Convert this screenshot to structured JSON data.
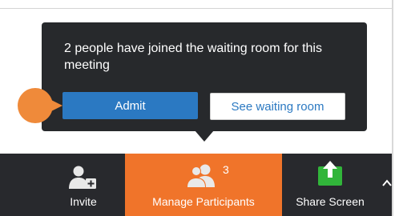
{
  "notification": {
    "message": "2 people have joined the waiting room for this meeting",
    "admit_label": "Admit",
    "see_waiting_room_label": "See waiting room"
  },
  "toolbar": {
    "invite_label": "Invite",
    "manage_participants_label": "Manage Participants",
    "participant_count": "3",
    "share_screen_label": "Share Screen"
  },
  "colors": {
    "popup_bg": "#27292c",
    "primary_blue": "#2b79c2",
    "active_orange": "#f0742a",
    "toolbar_bg": "#28292d",
    "share_green": "#31b53a",
    "pointer_orange": "#ef8a3a"
  },
  "icons": {
    "invite": "add-user-icon",
    "manage": "participants-icon",
    "share": "share-screen-icon",
    "more": "chevron-up-icon"
  }
}
